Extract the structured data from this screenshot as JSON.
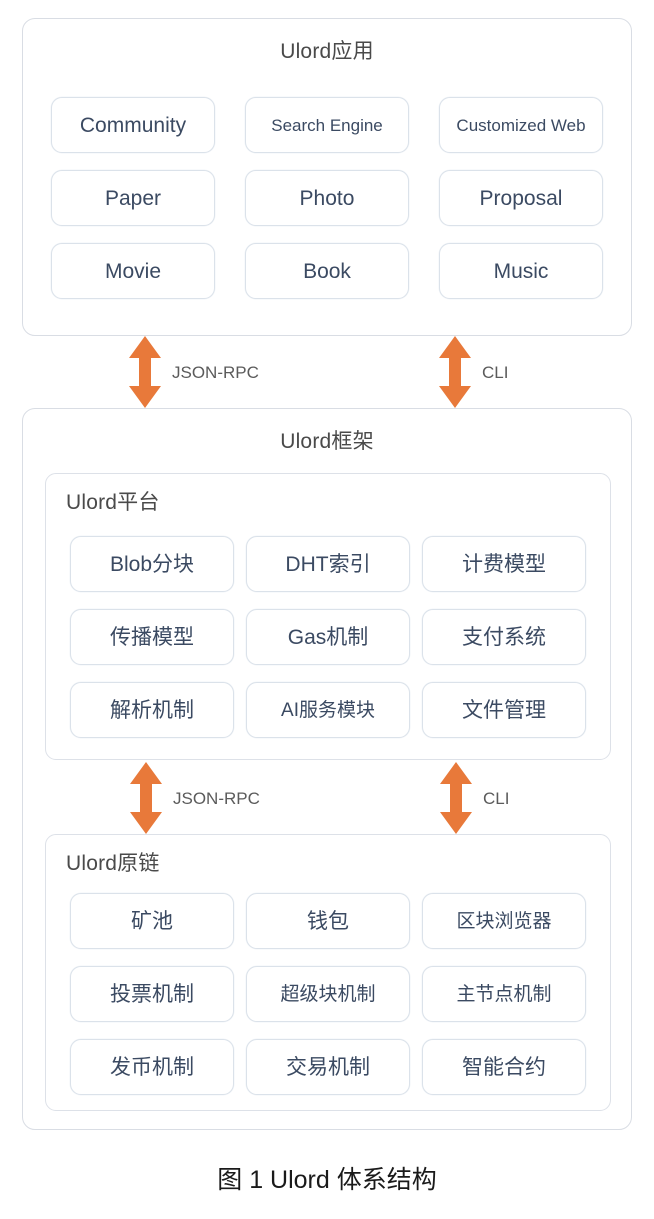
{
  "figure": {
    "caption": "图 1 Ulord 体系结构"
  },
  "layers": [
    {
      "id": "application",
      "title": "Ulord应用",
      "title_align": "center",
      "rows": [
        [
          "Community",
          "Search Engine",
          "Customized Web"
        ],
        [
          "Paper",
          "Photo",
          "Proposal"
        ],
        [
          "Movie",
          "Book",
          "Music"
        ]
      ]
    },
    {
      "id": "framework",
      "title": "Ulord框架",
      "title_align": "center",
      "subpanels": [
        {
          "id": "platform",
          "title": "Ulord平台",
          "title_align": "left",
          "rows": [
            [
              "Blob分块",
              "DHT索引",
              "计费模型"
            ],
            [
              "传播模型",
              "Gas机制",
              "支付系统"
            ],
            [
              "解析机制",
              "AI服务模块",
              "文件管理"
            ]
          ]
        },
        {
          "id": "chain",
          "title": "Ulord原链",
          "title_align": "left",
          "rows": [
            [
              "矿池",
              "钱包",
              "区块浏览器"
            ],
            [
              "投票机制",
              "超级块机制",
              "主节点机制"
            ],
            [
              "发币机制",
              "交易机制",
              "智能合约"
            ]
          ]
        }
      ]
    }
  ],
  "connectors": [
    {
      "id": "app-to-framework",
      "links": [
        {
          "label": "JSON-RPC",
          "icon": "double-arrow-vertical-icon"
        },
        {
          "label": "CLI",
          "icon": "double-arrow-vertical-icon"
        }
      ]
    },
    {
      "id": "platform-to-chain",
      "links": [
        {
          "label": "JSON-RPC",
          "icon": "double-arrow-vertical-icon"
        },
        {
          "label": "CLI",
          "icon": "double-arrow-vertical-icon"
        }
      ]
    }
  ],
  "colors": {
    "arrow": "#e8793a",
    "panel_border": "#d9dde4",
    "cell_border": "#dbe2ea",
    "cell_text": "#3b4a62",
    "title_text": "#4a4a4a",
    "label_text": "#5b5b5b",
    "caption_text": "#1a1a1a",
    "background": "#ffffff"
  }
}
